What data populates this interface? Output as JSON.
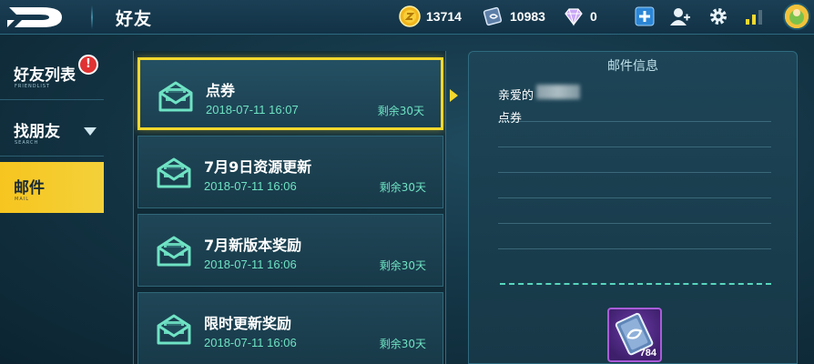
{
  "header": {
    "title": "好友",
    "logo_icon": "game-logo-icon"
  },
  "resources": {
    "gold": {
      "icon": "gold-coin-icon",
      "value": "13714"
    },
    "ticket": {
      "icon": "ticket-icon",
      "value": "10983"
    },
    "diamond": {
      "icon": "diamond-icon",
      "value": "0"
    }
  },
  "toolbar": {
    "add_icon": "plus-icon",
    "friends_icon": "friends-icon",
    "settings_icon": "gear-icon",
    "signal_icon": "signal-bars-icon",
    "avatar_icon": "avatar"
  },
  "sidebar": {
    "items": [
      {
        "cn": "好友列表",
        "en": "FRIENDLIST",
        "badge": "!"
      },
      {
        "cn": "找朋友",
        "en": "SEARCH"
      },
      {
        "cn": "邮件",
        "en": "MAIL",
        "active": true
      }
    ]
  },
  "mail_list": [
    {
      "title": "点券",
      "date": "2018-07-11 16:07",
      "remain": "剩余30天",
      "selected": true
    },
    {
      "title": "7月9日资源更新",
      "date": "2018-07-11 16:06",
      "remain": "剩余30天"
    },
    {
      "title": "7月新版本奖励",
      "date": "2018-07-11 16:06",
      "remain": "剩余30天"
    },
    {
      "title": "限时更新奖励",
      "date": "2018-07-11 16:06",
      "remain": "剩余30天"
    }
  ],
  "detail": {
    "header": "邮件信息",
    "greeting": "亲爱的",
    "body": "点券",
    "reward": {
      "icon": "ticket-icon",
      "count": "784"
    }
  },
  "colors": {
    "accent_yellow": "#f5d82e",
    "text_teal": "#6fe3c4",
    "badge_red": "#e03232",
    "reward_purple": "#a95cd8"
  }
}
